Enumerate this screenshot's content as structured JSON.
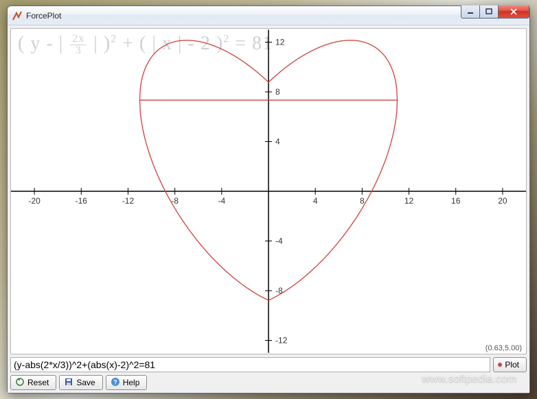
{
  "window": {
    "title": "ForcePlot"
  },
  "formula_display": "( y - | 2x/3 | )² + ( | x | - 2 )² = 81",
  "expression_input": "(y-abs(2*x/3))^2+(abs(x)-2)^2=81",
  "cursor_coords": "(0.63,5.00)",
  "buttons": {
    "plot": "Plot",
    "reset": "Reset",
    "save": "Save",
    "help": "Help"
  },
  "watermark": "www.softpedia.com",
  "chart_data": {
    "type": "implicit_curve",
    "equation": "(y - |2x/3|)^2 + (|x| - 2)^2 = 81",
    "title": "",
    "xlabel": "",
    "ylabel": "",
    "xlim": [
      -22,
      22
    ],
    "ylim": [
      -13,
      13
    ],
    "x_ticks": [
      -20,
      -16,
      -12,
      -8,
      -4,
      4,
      8,
      12,
      16,
      20
    ],
    "y_ticks": [
      -12,
      -8,
      -4,
      4,
      8,
      12
    ],
    "curve_color": "#d04040",
    "grid": false,
    "axes": true
  }
}
